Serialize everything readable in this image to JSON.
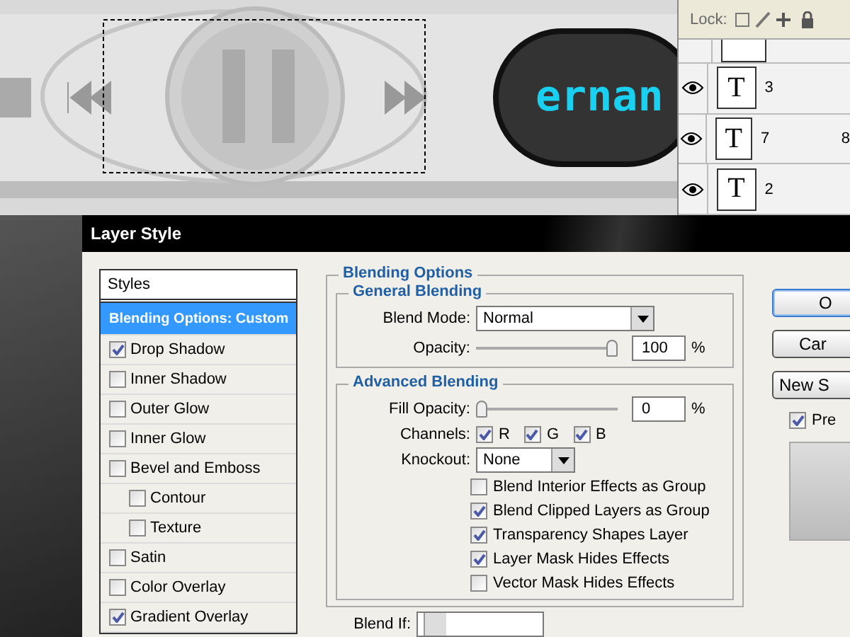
{
  "canvas": {
    "display_text": "ernan"
  },
  "layers_panel": {
    "lock_label": "Lock:",
    "layers": [
      {
        "name": "3",
        "thumbnail_text": "T",
        "visible": true
      },
      {
        "name": "7",
        "thumbnail_text": "T",
        "column_2": "8",
        "visible": true
      },
      {
        "name": "2",
        "thumbnail_text": "T",
        "visible": true
      }
    ]
  },
  "dialog": {
    "title": "Layer Style",
    "styles_header": "Styles",
    "styles": [
      {
        "label": "Blending Options: Custom",
        "kind": "header",
        "selected": true
      },
      {
        "label": "Drop Shadow",
        "kind": "effect",
        "checked": true,
        "selected": false
      },
      {
        "label": "Inner Shadow",
        "kind": "effect",
        "checked": false,
        "selected": false
      },
      {
        "label": "Outer Glow",
        "kind": "effect",
        "checked": false,
        "selected": false
      },
      {
        "label": "Inner Glow",
        "kind": "effect",
        "checked": false,
        "selected": false
      },
      {
        "label": "Bevel and Emboss",
        "kind": "effect",
        "checked": false,
        "selected": false
      },
      {
        "label": "Contour",
        "kind": "sub",
        "checked": false,
        "selected": false
      },
      {
        "label": "Texture",
        "kind": "sub",
        "checked": false,
        "selected": false
      },
      {
        "label": "Satin",
        "kind": "effect",
        "checked": false,
        "selected": false
      },
      {
        "label": "Color Overlay",
        "kind": "effect",
        "checked": false,
        "selected": false
      },
      {
        "label": "Gradient Overlay",
        "kind": "effect",
        "checked": true,
        "selected": false
      }
    ],
    "blending_options": {
      "title": "Blending Options",
      "general": {
        "title": "General Blending",
        "blend_mode": {
          "label": "Blend Mode:",
          "value": "Normal"
        },
        "opacity": {
          "label": "Opacity:",
          "level": 1,
          "value": "100",
          "unit": "%"
        }
      },
      "advanced": {
        "title": "Advanced Blending",
        "fill_opacity": {
          "label": "Fill Opacity:",
          "level": 0,
          "value": "0",
          "unit": "%"
        },
        "channels": {
          "label": "Channels:",
          "items": [
            {
              "label": "R",
              "checked": true
            },
            {
              "label": "G",
              "checked": true
            },
            {
              "label": "B",
              "checked": true
            }
          ]
        },
        "knockout": {
          "label": "Knockout:",
          "value": "None"
        },
        "options": [
          {
            "label": "Blend Interior Effects as Group",
            "checked": false
          },
          {
            "label": "Blend Clipped Layers as Group",
            "checked": true
          },
          {
            "label": "Transparency Shapes Layer",
            "checked": true
          },
          {
            "label": "Layer Mask Hides Effects",
            "checked": true
          },
          {
            "label": "Vector Mask Hides Effects",
            "checked": false
          }
        ]
      },
      "blend_if": {
        "label": "Blend If:"
      }
    },
    "buttons": [
      {
        "label": "O",
        "default": true
      },
      {
        "label": "Car",
        "default": false
      },
      {
        "label": "New S",
        "default": false
      }
    ],
    "preview": {
      "label": "Pre",
      "checked": true
    }
  }
}
